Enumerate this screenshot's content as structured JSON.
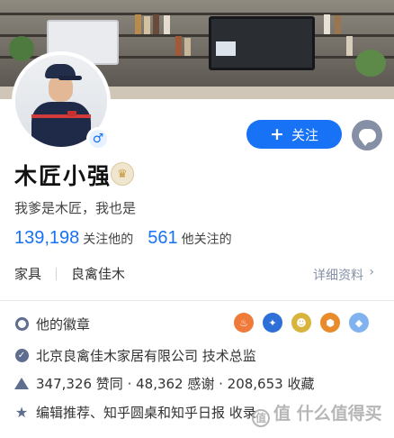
{
  "profile": {
    "name": "木匠小强",
    "bio": "我爹是木匠，我也是",
    "gender_symbol": "♂",
    "follow_label": "关注",
    "follow_plus": "+"
  },
  "stats": {
    "followers_count": "139,198",
    "followers_label": "关注他的",
    "following_count": "561",
    "following_label": "他关注的"
  },
  "tags": {
    "items": [
      "家具",
      "良禽佳木"
    ],
    "detail_label": "详细资料",
    "detail_arrow": "›"
  },
  "info_rows": {
    "medals_label": "他的徽章",
    "company": "北京良禽佳木家居有限公司 技术总监",
    "counts": "347,326 赞同 · 48,362 感谢 · 208,653 收藏",
    "recommend": "编辑推荐、知乎圆桌和知乎日报 收录"
  },
  "medals": [
    {
      "icon": "medal-orange-icon",
      "color": "#f07a3a"
    },
    {
      "icon": "medal-blue-icon",
      "color": "#2e6fd8"
    },
    {
      "icon": "medal-gold-icon",
      "color": "#d9b43c"
    },
    {
      "icon": "medal-orange2-icon",
      "color": "#e98a2b"
    },
    {
      "icon": "medal-lightblue-icon",
      "color": "#7fb2ef"
    }
  ],
  "watermark": {
    "text": "值 什么值得买"
  },
  "colors": {
    "accent": "#1772f6",
    "muted": "#8590a6"
  }
}
